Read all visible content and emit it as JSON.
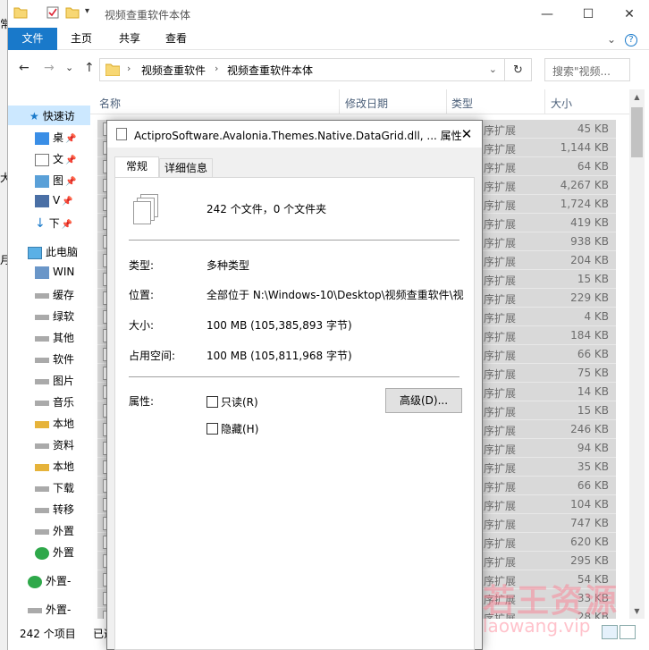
{
  "behind_window": {
    "chars": [
      "常",
      "大",
      "月"
    ]
  },
  "explorer": {
    "title": "视频查重软件本体",
    "ribbon": {
      "tabs": [
        "文件",
        "主页",
        "共享",
        "查看"
      ]
    },
    "address": {
      "crumbs": [
        "视频查重软件",
        "视频查重软件本体"
      ],
      "nav": {
        "back": "←",
        "forward": "→",
        "down": "⌄",
        "up": "↑",
        "refresh": "↻"
      }
    },
    "search_placeholder": "搜索\"视频...",
    "columns": {
      "name": "名称",
      "modified": "修改日期",
      "type": "类型",
      "size": "大小"
    },
    "nav_pane": {
      "quick_access": "快速访",
      "items": [
        "桌",
        "文",
        "图",
        "V",
        "下",
        "此电脑",
        "WIN",
        "缓存",
        "绿软",
        "其他",
        "软件",
        "图片",
        "音乐",
        "本地",
        "资料",
        "本地",
        "下载",
        "转移",
        "外置",
        "外置",
        "外置-",
        "外置-"
      ]
    },
    "rows": [
      {
        "type": "序扩展",
        "size": "45 KB"
      },
      {
        "type": "序扩展",
        "size": "1,144 KB"
      },
      {
        "type": "序扩展",
        "size": "64 KB"
      },
      {
        "type": "序扩展",
        "size": "4,267 KB"
      },
      {
        "type": "序扩展",
        "size": "1,724 KB"
      },
      {
        "type": "序扩展",
        "size": "419 KB"
      },
      {
        "type": "序扩展",
        "size": "938 KB"
      },
      {
        "type": "序扩展",
        "size": "204 KB"
      },
      {
        "type": "序扩展",
        "size": "15 KB"
      },
      {
        "type": "序扩展",
        "size": "229 KB"
      },
      {
        "type": "序扩展",
        "size": "4 KB"
      },
      {
        "type": "序扩展",
        "size": "184 KB"
      },
      {
        "type": "序扩展",
        "size": "66 KB"
      },
      {
        "type": "序扩展",
        "size": "75 KB"
      },
      {
        "type": "序扩展",
        "size": "14 KB"
      },
      {
        "type": "序扩展",
        "size": "15 KB"
      },
      {
        "type": "序扩展",
        "size": "246 KB"
      },
      {
        "type": "序扩展",
        "size": "94 KB"
      },
      {
        "type": "序扩展",
        "size": "35 KB"
      },
      {
        "type": "序扩展",
        "size": "66 KB"
      },
      {
        "type": "序扩展",
        "size": "104 KB"
      },
      {
        "type": "序扩展",
        "size": "747 KB"
      },
      {
        "type": "序扩展",
        "size": "620 KB"
      },
      {
        "type": "序扩展",
        "size": "295 KB"
      },
      {
        "type": "序扩展",
        "size": "54 KB"
      },
      {
        "type": "序扩展",
        "size": "33 KB"
      },
      {
        "type": "序扩展",
        "size": "28 KB"
      }
    ],
    "status": {
      "count": "242 个项目",
      "selected": "已选"
    }
  },
  "dialog": {
    "title": "ActiproSoftware.Avalonia.Themes.Native.DataGrid.dll, ... 属性",
    "close": "✕",
    "tabs": [
      "常规",
      "详细信息"
    ],
    "summary": "242 个文件，0 个文件夹",
    "fields": [
      {
        "label": "类型:",
        "value": "多种类型"
      },
      {
        "label": "位置:",
        "value": "全部位于 N:\\Windows-10\\Desktop\\视频查重软件\\视"
      },
      {
        "label": "大小:",
        "value": "100 MB (105,385,893 字节)"
      },
      {
        "label": "占用空间:",
        "value": "100 MB (105,811,968 字节)"
      }
    ],
    "attributes": {
      "label": "属性:",
      "readonly": "只读(R)",
      "hidden": "隐藏(H)",
      "advanced": "高级(D)..."
    }
  },
  "watermark": {
    "cn": "若王资源",
    "en": "laowang.vip"
  },
  "colors": {
    "accent": "#1979ca",
    "selection": "#d9d9d9",
    "watermark": "#ff7890"
  }
}
